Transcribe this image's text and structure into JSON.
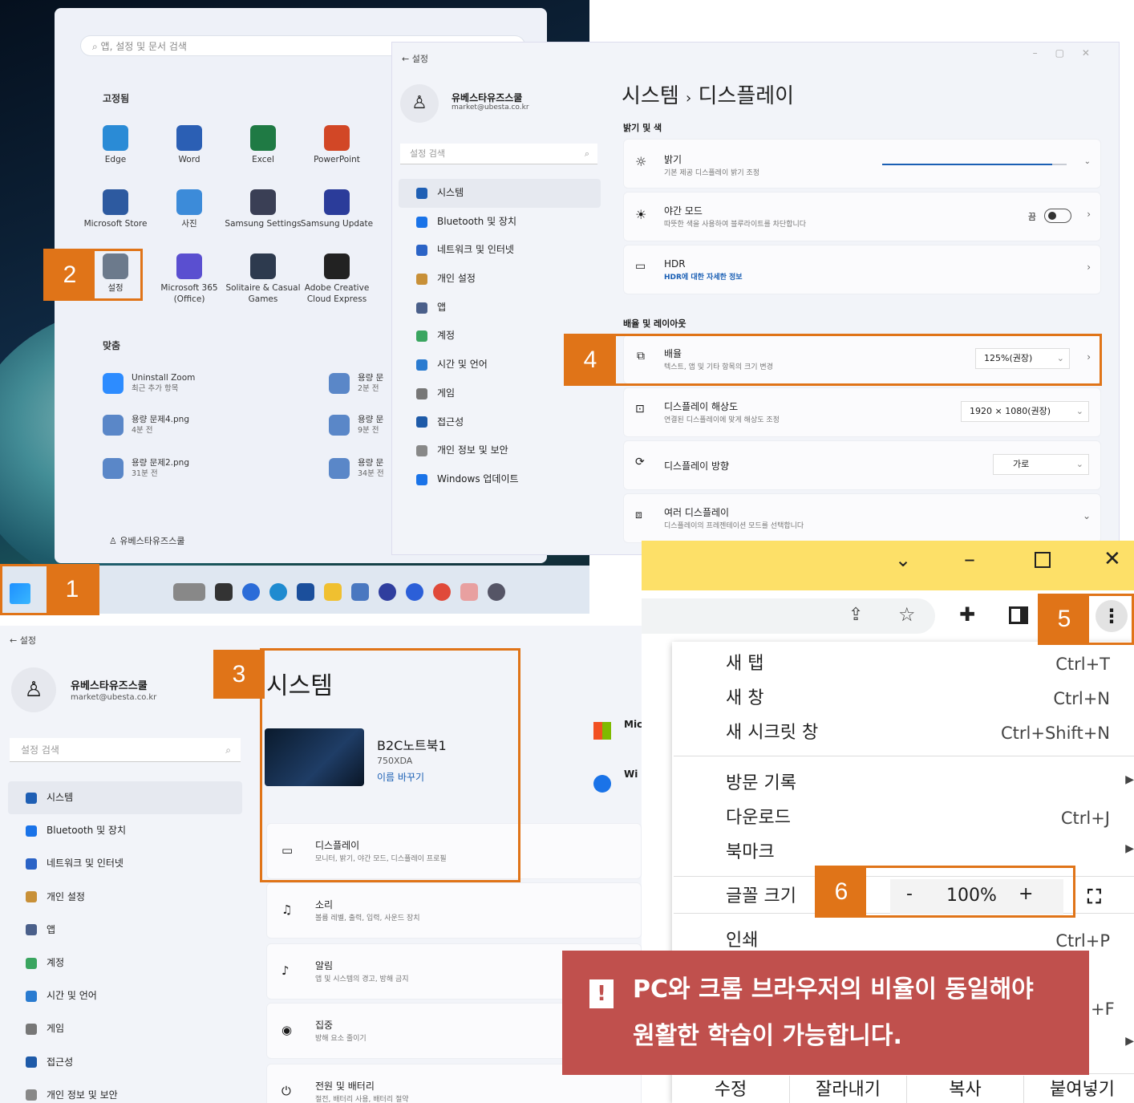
{
  "start_menu": {
    "search_placeholder": "앱, 설정 및 문서 검색",
    "pinned_title": "고정됨",
    "pinned_apps": [
      {
        "label": "Edge",
        "color": "#2a8bd6"
      },
      {
        "label": "Word",
        "color": "#2b5fb4"
      },
      {
        "label": "Excel",
        "color": "#1f7a44"
      },
      {
        "label": "PowerPoint",
        "color": "#d24726"
      },
      {
        "label": "Microsoft Store",
        "color": "#2d5aa0"
      },
      {
        "label": "사진",
        "color": "#3c8bd9"
      },
      {
        "label": "Samsung Settings",
        "color": "#3a3f55"
      },
      {
        "label": "Samsung Update",
        "color": "#2b3c9a"
      },
      {
        "label": "설정",
        "color": "#6c7a8c"
      },
      {
        "label": "Microsoft 365 (Office)",
        "color": "#5a4fd0"
      },
      {
        "label": "Solitaire & Casual Games",
        "color": "#2d3a4e"
      },
      {
        "label": "Adobe Creative Cloud Express",
        "color": "#222"
      }
    ],
    "recommended_title": "맞춤",
    "recent_items": [
      {
        "name": "Uninstall Zoom",
        "time": "최근 추가 항목",
        "color": "#2d8cff"
      },
      {
        "name": "용량 문제4.png",
        "time": "4분 전",
        "color": "#5a87c8"
      },
      {
        "name": "용량 문제2.png",
        "time": "31분 전",
        "color": "#5a87c8"
      },
      {
        "name": "용량 문",
        "time": "2분 전",
        "color": "#5a87c8"
      },
      {
        "name": "용량 문",
        "time": "9분 전",
        "color": "#5a87c8"
      },
      {
        "name": "용량 문",
        "time": "34분 전",
        "color": "#5a87c8"
      }
    ],
    "user_name": "유베스타유즈스쿨"
  },
  "badges": {
    "b1": "1",
    "b2": "2",
    "b3": "3",
    "b4": "4",
    "b5": "5",
    "b6": "6"
  },
  "display_settings": {
    "back_label": "설정",
    "user_name": "유베스타유즈스쿨",
    "user_email": "market@ubesta.co.kr",
    "search_placeholder": "설정 검색",
    "sidebar": [
      "시스템",
      "Bluetooth 및 장치",
      "네트워크 및 인터넷",
      "개인 설정",
      "앱",
      "계정",
      "시간 및 언어",
      "게임",
      "접근성",
      "개인 정보 및 보안",
      "Windows 업데이트"
    ],
    "breadcrumb_parent": "시스템",
    "breadcrumb_sep": "›",
    "breadcrumb_current": "디스플레이",
    "section_brightness": "밝기 및 색",
    "brightness_title": "밝기",
    "brightness_desc": "기본 제공 디스플레이 밝기 조정",
    "brightness_fraction": 0.92,
    "night_title": "야간 모드",
    "night_desc": "따뜻한 색을 사용하여 블루라이트를 차단합니다",
    "night_state": "끔",
    "hdr_title": "HDR",
    "hdr_link": "HDR에 대한 자세한 정보",
    "section_scale": "배율 및 레이아웃",
    "scale_title": "배율",
    "scale_desc": "텍스트, 앱 및 기타 항목의 크기 변경",
    "scale_value": "125%(권장)",
    "res_title": "디스플레이 해상도",
    "res_desc": "연결된 디스플레이에 맞게 해상도 조정",
    "res_value": "1920 × 1080(권장)",
    "orient_title": "디스플레이 방향",
    "orient_value": "가로",
    "multi_title": "여러 디스플레이",
    "multi_desc": "디스플레이의 프레젠테이션 모드를 선택합니다"
  },
  "system_settings": {
    "back_label": "설정",
    "user_name": "유베스타유즈스쿨",
    "user_email": "market@ubesta.co.kr",
    "search_placeholder": "설정 검색",
    "sidebar": [
      "시스템",
      "Bluetooth 및 장치",
      "네트워크 및 인터넷",
      "개인 설정",
      "앱",
      "계정",
      "시간 및 언어",
      "게임",
      "접근성",
      "개인 정보 및 보안"
    ],
    "page_title": "시스템",
    "device_name": "B2C노트북1",
    "device_model": "750XDA",
    "rename_link": "이름 바꾸기",
    "ms_label": "Mic",
    "win_label": "Wi",
    "items": [
      {
        "title": "디스플레이",
        "desc": "모니터, 밝기, 야간 모드, 디스플레이 프로필"
      },
      {
        "title": "소리",
        "desc": "볼륨 레벨, 출력, 입력, 사운드 장치"
      },
      {
        "title": "알림",
        "desc": "앱 및 시스템의 경고, 방해 금지"
      },
      {
        "title": "집중",
        "desc": "방해 요소 줄이기"
      },
      {
        "title": "전원 및 배터리",
        "desc": "절전, 배터리 사용, 배터리 절약"
      }
    ]
  },
  "chrome": {
    "titlebar_color": "#fde068",
    "menu": [
      {
        "label": "새 탭",
        "shortcut": "Ctrl+T"
      },
      {
        "label": "새 창",
        "shortcut": "Ctrl+N"
      },
      {
        "label": "새 시크릿 창",
        "shortcut": "Ctrl+Shift+N"
      },
      {
        "label": "방문 기록",
        "shortcut": ""
      },
      {
        "label": "다운로드",
        "shortcut": "Ctrl+J"
      },
      {
        "label": "북마크",
        "shortcut": ""
      },
      {
        "label": "글꼴 크기",
        "shortcut": ""
      },
      {
        "label": "인쇄",
        "shortcut": "Ctrl+P"
      }
    ],
    "zoom_minus": "-",
    "zoom_value": "100%",
    "zoom_plus": "+",
    "find_shortcut_fragment": "+F",
    "edit_row": [
      "수정",
      "잘라내기",
      "복사",
      "붙여넣기"
    ]
  },
  "alert": {
    "icon": "!",
    "line1": "PC와 크롬 브라우저의 비율이 동일해야",
    "line2": "원활한 학습이 가능합니다."
  }
}
